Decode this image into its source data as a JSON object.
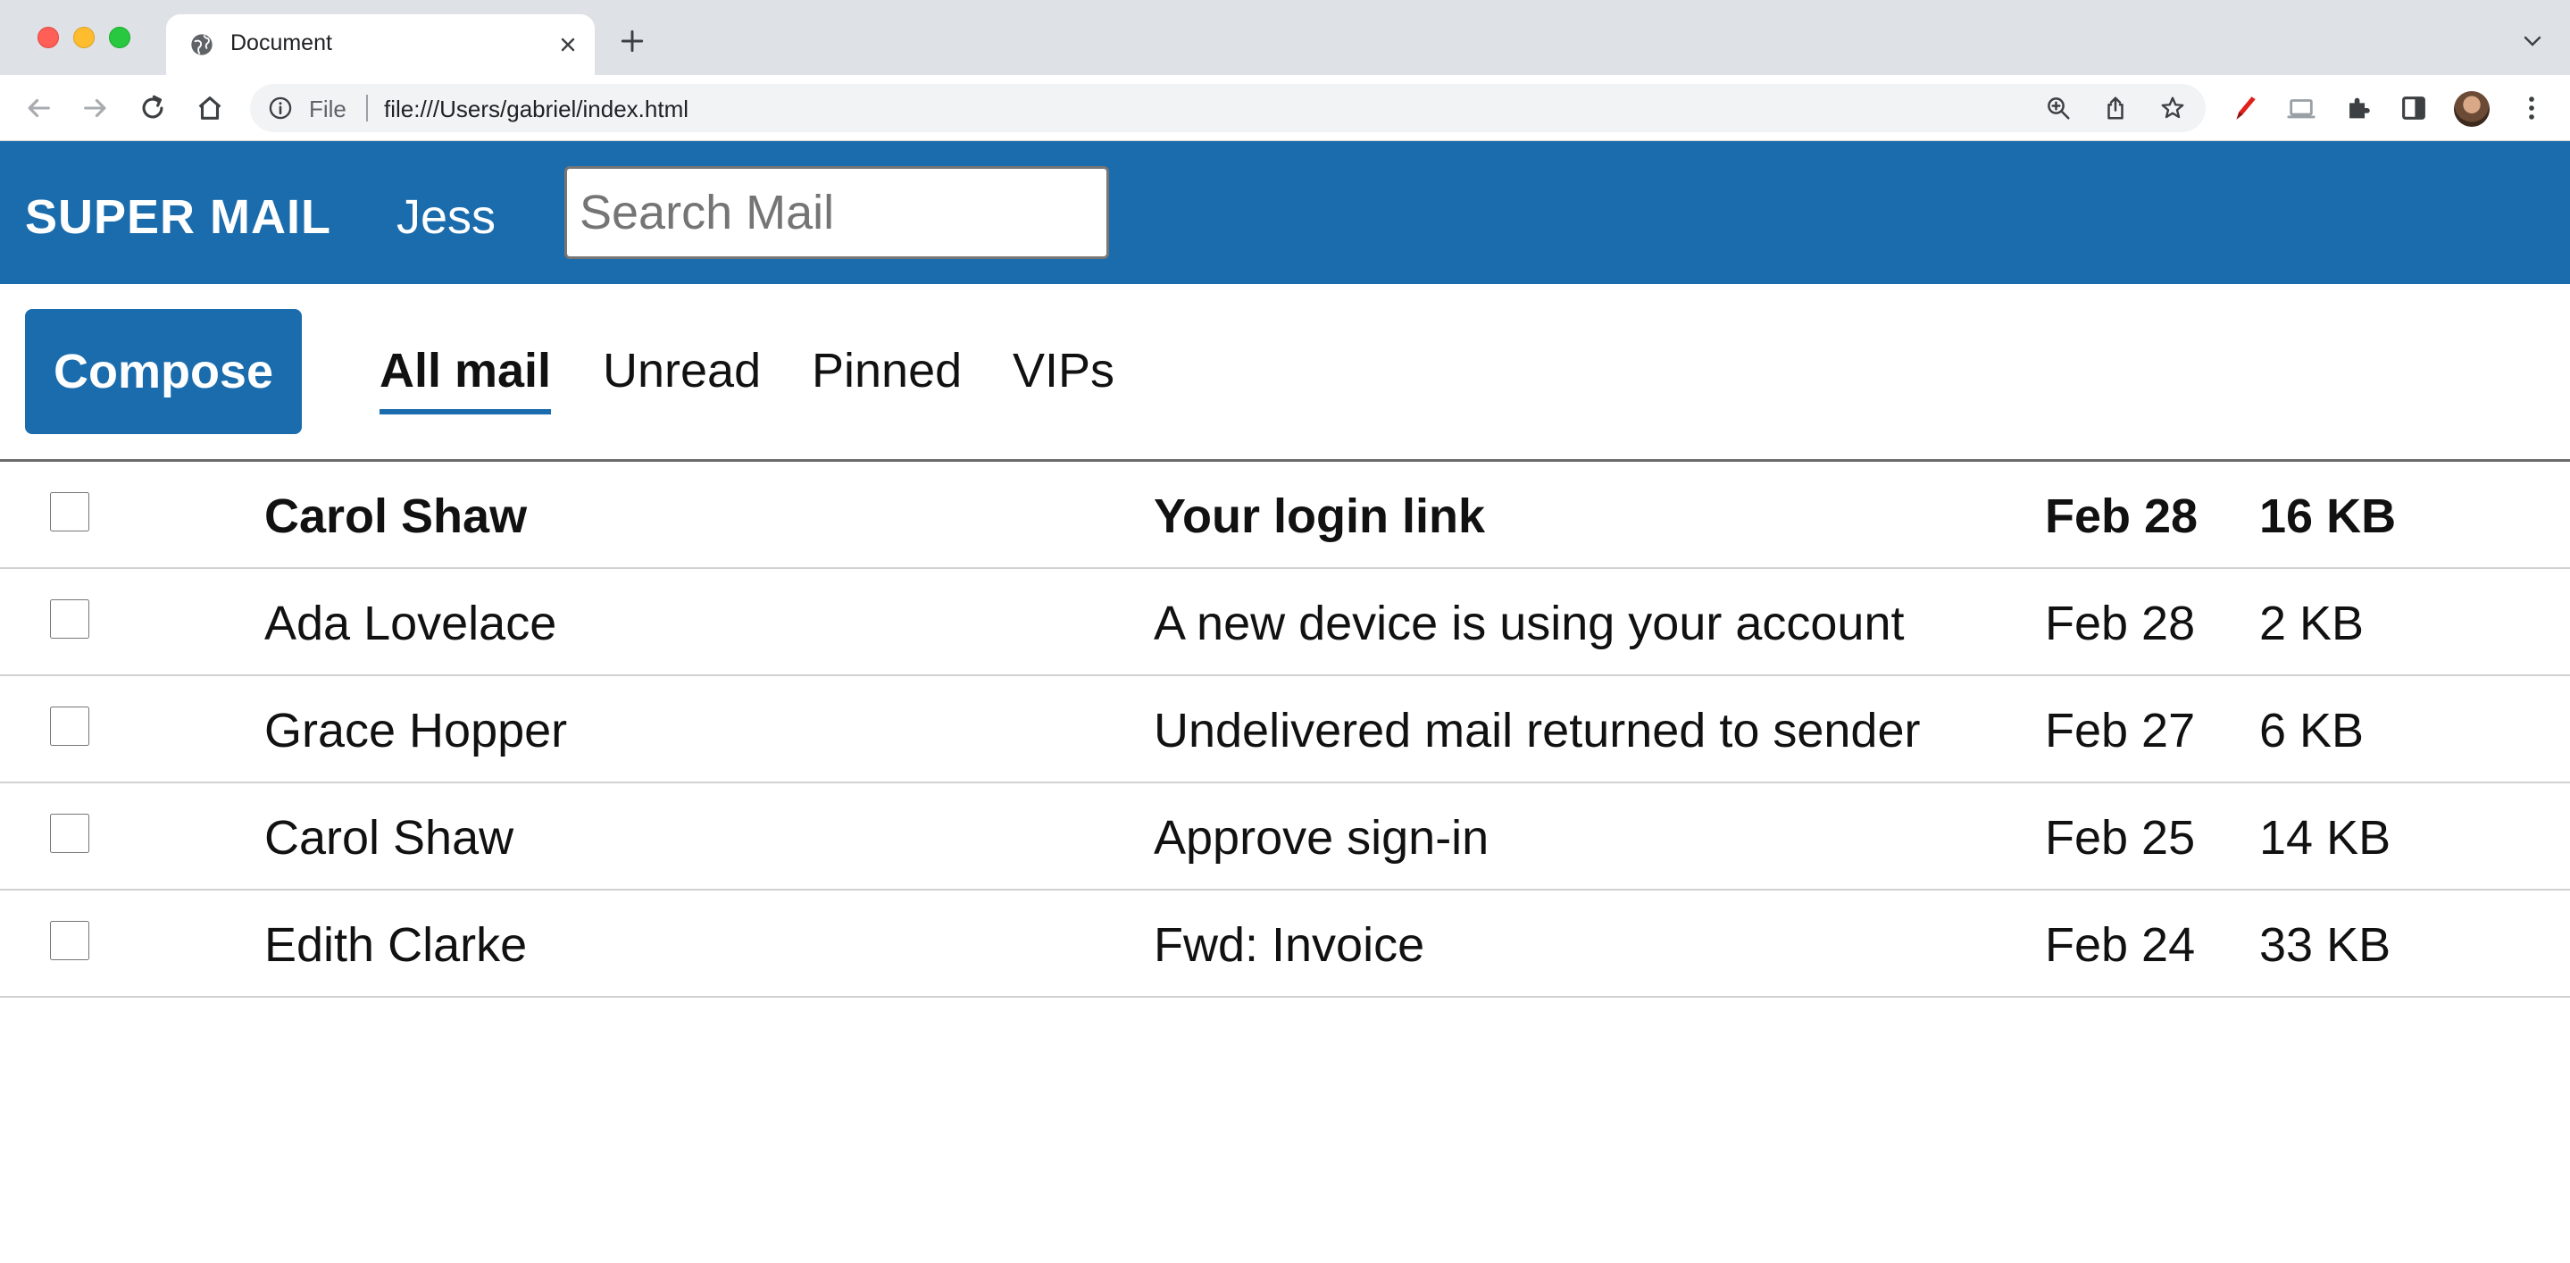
{
  "browser": {
    "tab_title": "Document",
    "address_scheme": "File",
    "address_url": "file:///Users/gabriel/index.html"
  },
  "app": {
    "brand": "SUPER MAIL",
    "user": "Jess",
    "search_placeholder": "Search Mail",
    "compose_label": "Compose",
    "tabs": [
      {
        "label": "All mail",
        "active": true
      },
      {
        "label": "Unread",
        "active": false
      },
      {
        "label": "Pinned",
        "active": false
      },
      {
        "label": "VIPs",
        "active": false
      }
    ],
    "accent_color": "#1b6cad"
  },
  "messages": [
    {
      "sender": "Carol Shaw",
      "subject": "Your login link",
      "date": "Feb 28",
      "size": "16 KB",
      "unread": true,
      "checked": false
    },
    {
      "sender": "Ada Lovelace",
      "subject": "A new device is using your account",
      "date": "Feb 28",
      "size": "2 KB",
      "unread": false,
      "checked": false
    },
    {
      "sender": "Grace Hopper",
      "subject": "Undelivered mail returned to sender",
      "date": "Feb 27",
      "size": "6 KB",
      "unread": false,
      "checked": false
    },
    {
      "sender": "Carol Shaw",
      "subject": "Approve sign-in",
      "date": "Feb 25",
      "size": "14 KB",
      "unread": false,
      "checked": false
    },
    {
      "sender": "Edith Clarke",
      "subject": "Fwd: Invoice",
      "date": "Feb 24",
      "size": "33 KB",
      "unread": false,
      "checked": false
    }
  ]
}
